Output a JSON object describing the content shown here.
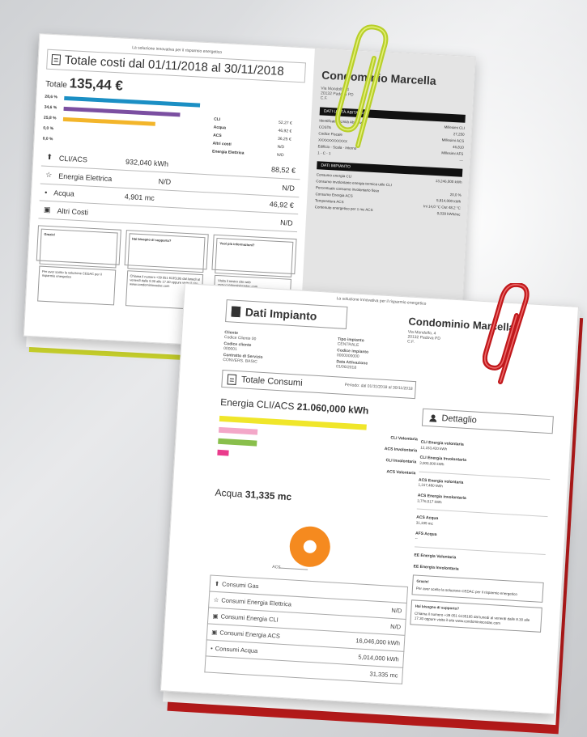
{
  "sheet1": {
    "top_note": "La soluzione innovativa per il risparmio energetico",
    "title": "Totale costi dal 01/11/2018 al 30/11/2018",
    "totale_label": "Totale",
    "totale_value": "135,44 €",
    "bars": [
      {
        "pct": "28,6 %",
        "color": "#1b8fc4",
        "fraction": 0.84
      },
      {
        "pct": "34,6 %",
        "color": "#7b4fa1",
        "fraction": 0.72
      },
      {
        "pct": "25,8 %",
        "color": "#f3b52a",
        "fraction": 0.57
      },
      {
        "pct": "0,0 %"
      },
      {
        "pct": "0,0 %"
      }
    ],
    "side_items": [
      {
        "label": "CLI",
        "value": "52,27 €"
      },
      {
        "label": "Acqua",
        "value": "46,92 €"
      },
      {
        "label": "ACS",
        "value": "36,25 €"
      },
      {
        "label": "Altri costi",
        "value": "N/D"
      },
      {
        "label": "Energia Elettrica",
        "value": "N/D"
      }
    ],
    "rows": [
      {
        "icon": "flame-icon",
        "label": "CLI/ACS",
        "mid": "932,040 kWh",
        "value": "88,52 €"
      },
      {
        "icon": "bulb-icon",
        "label": "Energia Elettrica",
        "mid": "N/D",
        "value": "N/D"
      },
      {
        "icon": "drop-icon",
        "label": "Acqua",
        "mid": "4,901 mc",
        "value": "46,92 €"
      },
      {
        "icon": "car-icon",
        "label": "Altri Costi",
        "mid": "",
        "value": "N/D"
      }
    ],
    "boxes": [
      {
        "title": "Grazie!",
        "text": "Per aver scelto la soluzione CEDAC per il risparmio energetico"
      },
      {
        "title": "Hai bisogno di supporto?",
        "text": "Chiama il numero +39 051 6135195 dal lunedì al venerdì dalle 8.30 alle 17.30 oppure visita il sito www.condominiocedac.com"
      },
      {
        "title": "Vuoi più informazioni?",
        "text": "Visita il nostro sito web www.condominiocedac.com"
      }
    ],
    "right": {
      "name": "Condominio Marcella",
      "address": "Via Mondolfo, 4\n20132 Padova PD\nC.F.",
      "band1": "DATI UNITÀ ABITATIVA",
      "kv1": [
        {
          "k": "Identificativo Unità Abitativa",
          "v": "Millesimi CLI"
        },
        {
          "k": "COSTA",
          "v": "27,250"
        },
        {
          "k": "Codice Fiscale",
          "v": "Millesimi ACS"
        },
        {
          "k": "XXXXXXXXXXXX",
          "v": "46,810"
        },
        {
          "k": "Edificio - Scala - Interno",
          "v": "Millesimi AFS"
        },
        {
          "k": "1 - C - 1",
          "v": "---"
        }
      ],
      "band2": "DATI IMPIANTO",
      "kv2": [
        {
          "k": "Consumo energia CLI",
          "v": "13,246,000 kWh"
        },
        {
          "k": "Consumo involontario energia termica utile CLI",
          "v": ""
        },
        {
          "k": "Percentuale consumo involontario fisso",
          "v": "20,0 %"
        },
        {
          "k": "Consumo Energia ACS",
          "v": "5,814,000 kWh"
        },
        {
          "k": "Temperatura ACS",
          "v": "Ini 14,0 °C Out 48,2 °C"
        },
        {
          "k": "Contenuto energetico per 1 mc ACS",
          "v": "0,039 kWh/mc"
        }
      ]
    }
  },
  "sheet2": {
    "top_note": "La soluzione innovativa per il risparmio energetico",
    "title": "Dati Impianto",
    "condo": "Condominio Marcella",
    "address": "Via Mondolfo, 4\n20132 Padova PD\nC.F.",
    "info": [
      {
        "k": "Cliente",
        "v": "Codice Cliente 00"
      },
      {
        "k": "Tipo impianto",
        "v": "CENTRALE"
      },
      {
        "k": "Codice cliente",
        "v": "000001"
      },
      {
        "k": "Codice impianto",
        "v": "0000000000"
      },
      {
        "k": "Contratto di Servizio",
        "v": "CONVERS. BASIC"
      },
      {
        "k": "Data Attivazione",
        "v": "01/06/2018"
      }
    ],
    "consumi_title": "Totale Consumi",
    "periodo": "Periodo: dal 01/11/2018 al 30/11/2018",
    "dettaglio_title": "Dettaglio",
    "energy_label": "Energia CLI/ACS",
    "energy_value": "21.060,000 kWh",
    "energy_bars": [
      {
        "label": "CLI Volontaria",
        "color": "#f0e62a",
        "fraction": 0.76
      },
      {
        "label": "ACS Involontaria",
        "color": "#f3a7c8",
        "fraction": 0.2
      },
      {
        "label": "CLI Involontaria",
        "color": "#89bf4c",
        "fraction": 0.2
      },
      {
        "label": "ACS Volontaria",
        "color": "#ea3b8c",
        "fraction": 0.06
      }
    ],
    "acqua_label": "Acqua",
    "acqua_value": "31,335 mc",
    "donut_label": "ACS",
    "rows": [
      {
        "icon": "gas-icon",
        "label": "Consumi Gas",
        "value": ""
      },
      {
        "icon": "bulb-icon",
        "label": "Consumi Energia Elettrica",
        "value": "N/D"
      },
      {
        "icon": "car-icon",
        "label": "Consumi Energia CLI",
        "value": "N/D"
      },
      {
        "icon": "car-icon",
        "label": "Consumi Energia ACS",
        "value": "16,046,000 kWh"
      },
      {
        "icon": "drop-icon",
        "label": "Consumi Acqua",
        "value": "5,014,000 kWh"
      },
      {
        "icon": "",
        "label": "",
        "value": "31,335 mc"
      }
    ],
    "dettaglio": [
      {
        "k": "CLI Energia volontaria",
        "v": "12,153,420 kWh"
      },
      {
        "k": "CLI Energia Involontaria",
        "v": "3,000,000 kWh"
      },
      {
        "k": "ACS Energia volontaria",
        "v": "1,317,480 kWh"
      },
      {
        "k": "ACS Energia involontaria",
        "v": "3,776,517 kWh"
      },
      {
        "k": "ACS Acqua",
        "v": "31,335 mc"
      },
      {
        "k": "AFS Acqua",
        "v": "--"
      },
      {
        "k": "EE Energia Volontaria",
        "v": ""
      },
      {
        "k": "EE Energia Involontaria",
        "v": ""
      }
    ],
    "grazie_title": "Grazie!",
    "grazie_text": "Per aver scelto la soluzione CEDAC per il risparmio energetico",
    "support_title": "Hai bisogno di supporto?",
    "support_text": "Chiama il numero +39 051 6135195 dal lunedì al venerdì dalle 8.30 alle 17.30 oppure visita il sito www.condominiocedac.com"
  },
  "colors": {
    "clip_green": "#b8cf2a",
    "clip_red": "#c0181b",
    "accent_yellow": "#c6cf2b",
    "accent_red": "#b41a1a"
  }
}
